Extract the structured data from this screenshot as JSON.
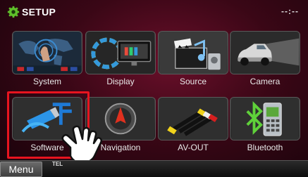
{
  "header": {
    "title": "SETUP",
    "clock": "--:--",
    "icon": "gear-icon"
  },
  "tiles": [
    {
      "label": "System",
      "icon": "world-map-hand-icon"
    },
    {
      "label": "Display",
      "icon": "color-ring-monitor-icon"
    },
    {
      "label": "Source",
      "icon": "clapperboard-music-icon"
    },
    {
      "label": "Camera",
      "icon": "car-camera-icon"
    },
    {
      "label": "Software",
      "icon": "usb-stick-icon",
      "selected": true
    },
    {
      "label": "Navigation",
      "icon": "compass-arrow-icon"
    },
    {
      "label": "AV-OUT",
      "icon": "av-cable-icon"
    },
    {
      "label": "Bluetooth",
      "icon": "bluetooth-phone-icon"
    }
  ],
  "bottom": {
    "menu_label": "Menu",
    "tel_label": "TEL"
  },
  "colors": {
    "selection": "#e8141f",
    "background": "#3a0716"
  }
}
